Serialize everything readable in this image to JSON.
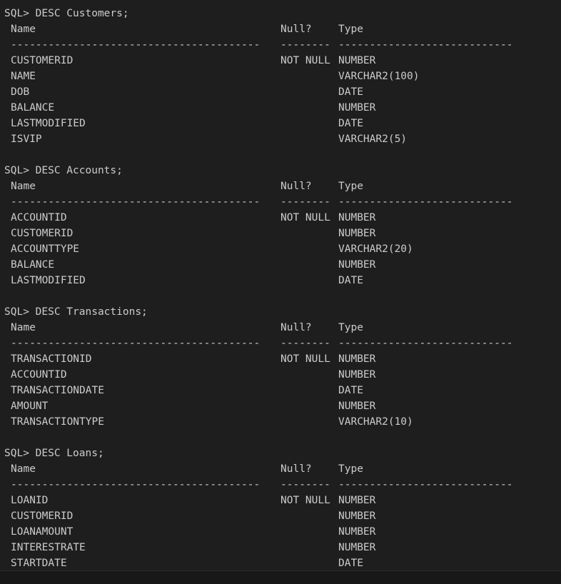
{
  "blocks": [
    {
      "prompt": "SQL> DESC Customers;",
      "headers": {
        "name": "Name",
        "null": "Null?",
        "type": "Type"
      },
      "dividers": {
        "name": "----------------------------------------",
        "null": "--------",
        "type": "----------------------------"
      },
      "rows": [
        {
          "name": "CUSTOMERID",
          "null": "NOT NULL",
          "type": "NUMBER"
        },
        {
          "name": "NAME",
          "null": "",
          "type": "VARCHAR2(100)"
        },
        {
          "name": "DOB",
          "null": "",
          "type": "DATE"
        },
        {
          "name": "BALANCE",
          "null": "",
          "type": "NUMBER"
        },
        {
          "name": "LASTMODIFIED",
          "null": "",
          "type": "DATE"
        },
        {
          "name": "ISVIP",
          "null": "",
          "type": "VARCHAR2(5)"
        }
      ]
    },
    {
      "prompt": "SQL> DESC Accounts;",
      "headers": {
        "name": "Name",
        "null": "Null?",
        "type": "Type"
      },
      "dividers": {
        "name": "----------------------------------------",
        "null": "--------",
        "type": "----------------------------"
      },
      "rows": [
        {
          "name": "ACCOUNTID",
          "null": "NOT NULL",
          "type": "NUMBER"
        },
        {
          "name": "CUSTOMERID",
          "null": "",
          "type": "NUMBER"
        },
        {
          "name": "ACCOUNTTYPE",
          "null": "",
          "type": "VARCHAR2(20)"
        },
        {
          "name": "BALANCE",
          "null": "",
          "type": "NUMBER"
        },
        {
          "name": "LASTMODIFIED",
          "null": "",
          "type": "DATE"
        }
      ]
    },
    {
      "prompt": "SQL> DESC Transactions;",
      "headers": {
        "name": "Name",
        "null": "Null?",
        "type": "Type"
      },
      "dividers": {
        "name": "----------------------------------------",
        "null": "--------",
        "type": "----------------------------"
      },
      "rows": [
        {
          "name": "TRANSACTIONID",
          "null": "NOT NULL",
          "type": "NUMBER"
        },
        {
          "name": "ACCOUNTID",
          "null": "",
          "type": "NUMBER"
        },
        {
          "name": "TRANSACTIONDATE",
          "null": "",
          "type": "DATE"
        },
        {
          "name": "AMOUNT",
          "null": "",
          "type": "NUMBER"
        },
        {
          "name": "TRANSACTIONTYPE",
          "null": "",
          "type": "VARCHAR2(10)"
        }
      ]
    },
    {
      "prompt": "SQL> DESC Loans;",
      "headers": {
        "name": "Name",
        "null": "Null?",
        "type": "Type"
      },
      "dividers": {
        "name": "----------------------------------------",
        "null": "--------",
        "type": "----------------------------"
      },
      "rows": [
        {
          "name": "LOANID",
          "null": "NOT NULL",
          "type": "NUMBER"
        },
        {
          "name": "CUSTOMERID",
          "null": "",
          "type": "NUMBER"
        },
        {
          "name": "LOANAMOUNT",
          "null": "",
          "type": "NUMBER"
        },
        {
          "name": "INTERESTRATE",
          "null": "",
          "type": "NUMBER"
        },
        {
          "name": "STARTDATE",
          "null": "",
          "type": "DATE"
        }
      ]
    }
  ],
  "colors": {
    "background": "#1e1e1e",
    "text": "#cccccc"
  }
}
